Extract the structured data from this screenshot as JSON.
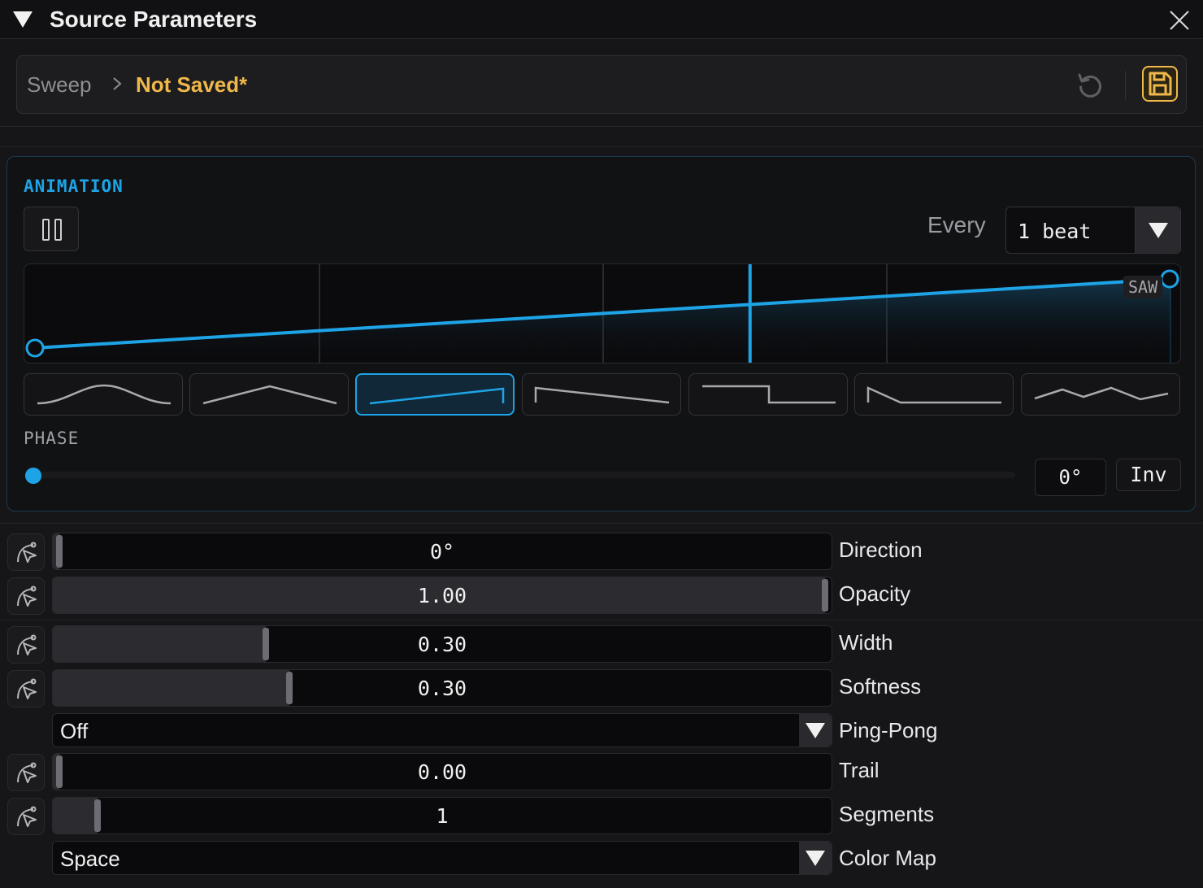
{
  "window": {
    "title": "Source Parameters"
  },
  "breadcrumb": {
    "root": "Sweep",
    "current": "Not Saved*"
  },
  "icons": {
    "collapse": "triangle-down-icon",
    "close": "close-icon",
    "separator": "chevron-right-icon",
    "revert": "revert-icon",
    "save": "save-icon",
    "pause": "pause-icon",
    "modulate": "modulate-icon"
  },
  "colors": {
    "accent": "#1ea4e6",
    "unsaved": "#f0b84a"
  },
  "animation": {
    "heading": "ANIMATION",
    "every_label": "Every",
    "every_value": "1 beat",
    "waveform_tag": "SAW",
    "playhead_position": 0.63,
    "shapes": [
      {
        "id": "sine",
        "selected": false
      },
      {
        "id": "triangle",
        "selected": false
      },
      {
        "id": "saw",
        "selected": true
      },
      {
        "id": "ramp-down",
        "selected": false
      },
      {
        "id": "square",
        "selected": false
      },
      {
        "id": "decay",
        "selected": false
      },
      {
        "id": "random",
        "selected": false
      }
    ],
    "phase": {
      "label": "PHASE",
      "value": "0°",
      "fraction": 0,
      "invert_label": "Inv"
    }
  },
  "params": {
    "direction": {
      "label": "Direction",
      "value": "0°",
      "fraction": 0.0
    },
    "opacity": {
      "label": "Opacity",
      "value": "1.00",
      "fraction": 1.0
    },
    "width": {
      "label": "Width",
      "value": "0.30",
      "fraction": 0.27
    },
    "softness": {
      "label": "Softness",
      "value": "0.30",
      "fraction": 0.3
    },
    "pingpong": {
      "label": "Ping-Pong",
      "value": "Off"
    },
    "trail": {
      "label": "Trail",
      "value": "0.00",
      "fraction": 0.0
    },
    "segments": {
      "label": "Segments",
      "value": "1",
      "fraction": 0.05
    },
    "colormap": {
      "label": "Color Map",
      "value": "Space"
    }
  }
}
